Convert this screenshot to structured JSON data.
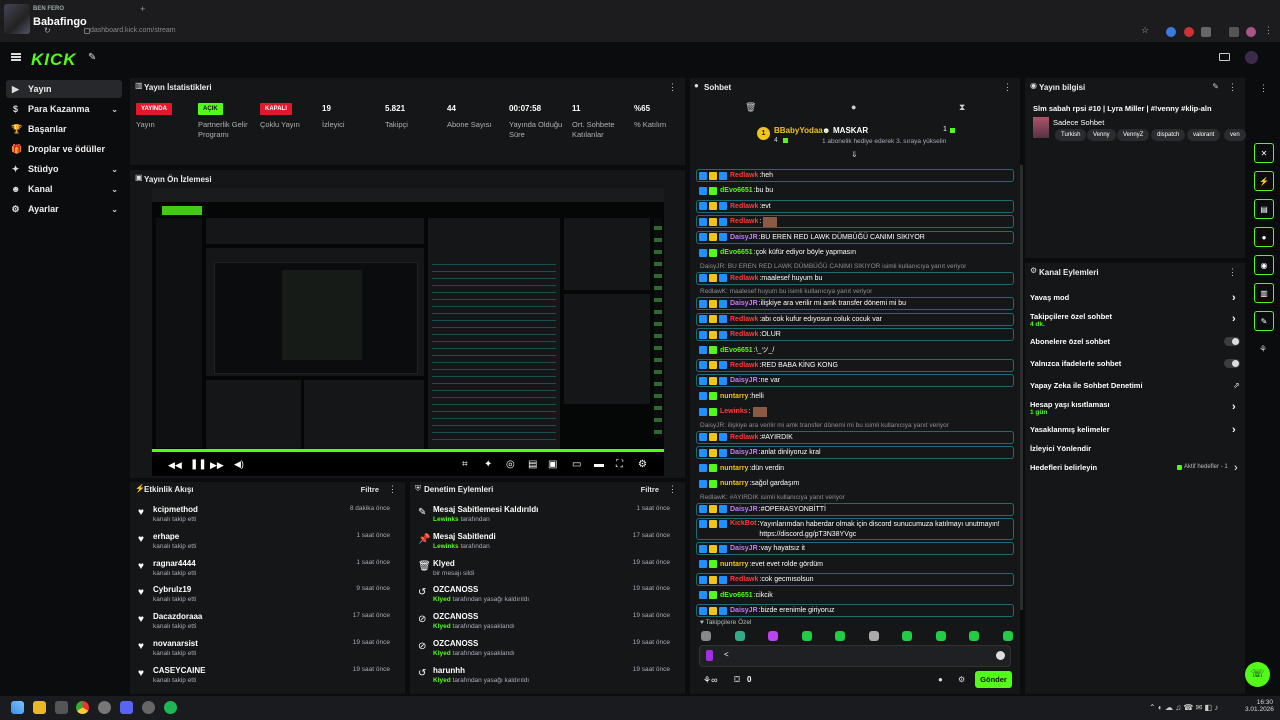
{
  "browser": {
    "profile_sub": "BEN FERO",
    "profile_name": "Babafingo",
    "url": "dashboard.kick.com/stream"
  },
  "header": {
    "logo": "KICK"
  },
  "sidebar": {
    "items": [
      {
        "label": "Yayın",
        "icon": "video-icon",
        "active": true,
        "expand": false
      },
      {
        "label": "Para Kazanma",
        "icon": "money-icon",
        "expand": true
      },
      {
        "label": "Başarılar",
        "icon": "trophy-icon",
        "expand": false
      },
      {
        "label": "Droplar ve ödüller",
        "icon": "gift-icon",
        "expand": false
      },
      {
        "label": "Stüdyo",
        "icon": "studio-icon",
        "expand": true
      },
      {
        "label": "Kanal",
        "icon": "user-icon",
        "expand": true
      },
      {
        "label": "Ayarlar",
        "icon": "gear-icon",
        "expand": true
      }
    ]
  },
  "stats": {
    "title": "Yayın İstatistikleri",
    "items": [
      {
        "badge": "YAYINDA",
        "label": "Yayın"
      },
      {
        "badge": "AÇIK",
        "label": "Partnerlik Gelir Programı"
      },
      {
        "badge": "KAPALI",
        "label": "Çoklu Yayın"
      },
      {
        "value": "19",
        "label": "İzleyici"
      },
      {
        "value": "5.821",
        "label": "Takipçi"
      },
      {
        "value": "44",
        "label": "Abone Sayısı"
      },
      {
        "value": "00:07:58",
        "label": "Yayında Olduğu Süre"
      },
      {
        "value": "11",
        "label": "Ort. Sohbete Katılanlar"
      },
      {
        "value": "%65",
        "label": "% Katılım"
      }
    ]
  },
  "preview": {
    "title": "Yayın Ön İzlemesi"
  },
  "activity": {
    "title": "Etkinlik Akışı",
    "filter": "Filtre",
    "rows": [
      {
        "name": "kcipmethod",
        "sub": "kanalı takip etti",
        "time": "8 dakika önce"
      },
      {
        "name": "erhape",
        "sub": "kanalı takip etti",
        "time": "1 saat önce"
      },
      {
        "name": "ragnar4444",
        "sub": "kanalı takip etti",
        "time": "1 saat önce"
      },
      {
        "name": "Cybrulz19",
        "sub": "kanalı takip etti",
        "time": "9 saat önce"
      },
      {
        "name": "Dacazdoraaa",
        "sub": "kanalı takip etti",
        "time": "17 saat önce"
      },
      {
        "name": "novanarsist",
        "sub": "kanalı takip etti",
        "time": "19 saat önce"
      },
      {
        "name": "CASEYCAINE",
        "sub": "kanalı takip etti",
        "time": "19 saat önce"
      }
    ]
  },
  "moderation": {
    "title": "Denetim Eylemleri",
    "filter": "Filtre",
    "rows": [
      {
        "icon": "unpin-icon",
        "name": "Mesaj Sabitlemesi Kaldırıldı",
        "actor": "Lewinks",
        "sub": "tarafından",
        "time": "1 saat önce"
      },
      {
        "icon": "pin-icon",
        "name": "Mesaj Sabitlendi",
        "actor": "Lewinks",
        "sub": "tarafından",
        "time": "17 saat önce"
      },
      {
        "icon": "trash-icon",
        "name": "Klyed",
        "actor": "",
        "sub": "bir mesajı sildi",
        "time": "19 saat önce"
      },
      {
        "icon": "undo-icon",
        "name": "OZCANOSS",
        "actor": "Klyed",
        "sub": "tarafından yasağı kaldırıldı",
        "time": "19 saat önce"
      },
      {
        "icon": "ban-icon",
        "name": "OZCANOSS",
        "actor": "Klyed",
        "sub": "tarafından yasaklandı",
        "time": "19 saat önce"
      },
      {
        "icon": "ban-icon",
        "name": "OZCANOSS",
        "actor": "Klyed",
        "sub": "tarafından yasaklandı",
        "time": "19 saat önce"
      },
      {
        "icon": "undo-icon",
        "name": "harunhh",
        "actor": "Klyed",
        "sub": "tarafından yasağı kaldırıldı",
        "time": "19 saat önce"
      }
    ]
  },
  "chat": {
    "title": "Sohbet",
    "pinned_user": "BBabyYodaa",
    "pinned_num": "4",
    "pinned_target": "MASKAR",
    "pinned_count": "1",
    "pinned_msg": "1 abonelik hediye ederek 3. sıraya yükselin",
    "messages": [
      {
        "user": "Redlawk",
        "color": "#ff3b3b",
        "text": "heh"
      },
      {
        "user": "dEvo6651",
        "color": "#53fc18",
        "text": "bu bu",
        "plain": true
      },
      {
        "user": "Redlawk",
        "color": "#ff3b3b",
        "text": "evt"
      },
      {
        "user": "Redlawk",
        "color": "#ff3b3b",
        "text": ""
      },
      {
        "user": "DaisyJR",
        "color": "#c57cff",
        "text": "BU EREN RED LAWK DÜMBÜĞÜ CANIMI SIKIYOR"
      },
      {
        "user": "dEvo6651",
        "color": "#53fc18",
        "text": "çok küfür ediyor böyle yapmasın",
        "plain": true
      },
      {
        "reply": "DaisyJR: BU EREN RED LAWK DÜMBÜĞÜ CANIMI SIKIYOR isimli kullanıcıya yanıt veriyor"
      },
      {
        "user": "Redlawk",
        "color": "#ff3b3b",
        "text": "maalesef huyum bu"
      },
      {
        "reply": "RedlawK: maalesef huyum bu isimli kullanıcıya yanıt veriyor"
      },
      {
        "user": "DaisyJR",
        "color": "#c57cff",
        "text": "ilişkiye ara verilir mi amk transfer dönemi mi bu"
      },
      {
        "user": "Redlawk",
        "color": "#ff3b3b",
        "text": "abı cok kufur edıyosun coluk cocuk var"
      },
      {
        "user": "Redlawk",
        "color": "#ff3b3b",
        "text": "OLUR"
      },
      {
        "user": "dEvo6651",
        "color": "#53fc18",
        "text": "\\_ツ_/",
        "plain": true
      },
      {
        "user": "Redlawk",
        "color": "#ff3b3b",
        "text": "RED BABA KİNG KONG"
      },
      {
        "user": "DaisyJR",
        "color": "#c57cff",
        "text": "ne var"
      },
      {
        "user": "nuntarry",
        "color": "#f0c419",
        "text": "helli",
        "plain": true
      },
      {
        "user": "Lewinks",
        "color": "#ff3b3b",
        "text": "",
        "plain": true
      },
      {
        "reply": "DaisyJR: ilişkiye ara verilir mi amk transfer dönemi mi bu isimli kullanıcıya yanıt veriyor"
      },
      {
        "user": "Redlawk",
        "color": "#ff3b3b",
        "text": "#AYIRDIK"
      },
      {
        "user": "DaisyJR",
        "color": "#c57cff",
        "text": "anlat dinliyoruz kral"
      },
      {
        "user": "nuntarry",
        "color": "#f0c419",
        "text": "dün verdin",
        "plain": true
      },
      {
        "user": "nuntarry",
        "color": "#f0c419",
        "text": "sağol gardaşım",
        "plain": true
      },
      {
        "reply": "RedlawK: #AYIRDIK isimli kullanıcıya yanıt veriyor"
      },
      {
        "user": "DaisyJR",
        "color": "#c57cff",
        "text": "#OPERASYONBİTTİ"
      },
      {
        "user": "KickBot",
        "color": "#ff3b3b",
        "text": "Yayınlarımdan haberdar olmak için discord sunucumuza katılmayı unutmayın! https://discord.gg/pT3N38YVgc",
        "tall": true
      },
      {
        "user": "DaisyJR",
        "color": "#c57cff",
        "text": "vay hayatsız it"
      },
      {
        "user": "nuntarry",
        "color": "#f0c419",
        "text": "evet evet rolde gördüm",
        "plain": true
      },
      {
        "user": "Redlawk",
        "color": "#ff3b3b",
        "text": "cok gecmısolsun"
      },
      {
        "user": "dEvo6651",
        "color": "#53fc18",
        "text": "cikcik",
        "plain": true
      },
      {
        "user": "DaisyJR",
        "color": "#c57cff",
        "text": "bizde erenimle giriyoruz"
      }
    ],
    "emote_label": "Takipçilere Özel",
    "input_value": "<",
    "count": "0",
    "send_label": "Gönder"
  },
  "stream_info": {
    "title": "Yayın bilgisi",
    "stream_title": "Slm sabah rpsi #10 | Lyra Miller | #!venny #klip-aln",
    "category": "Sadece Sohbet",
    "tags": [
      "Turkish",
      "Venny",
      "VennyZ",
      "dispatch",
      "valorant",
      "ven"
    ]
  },
  "channel_actions": {
    "title": "Kanal Eylemleri",
    "rows": [
      {
        "label": "Yavaş mod",
        "sub": "",
        "control": "chevron"
      },
      {
        "label": "Takipçilere özel sohbet",
        "sub": "4 dk.",
        "control": "chevron"
      },
      {
        "label": "Abonelere özel sohbet",
        "sub": "",
        "control": "toggle"
      },
      {
        "label": "Yalnızca ifadelerle sohbet",
        "sub": "",
        "control": "toggle"
      },
      {
        "label": "Yapay Zeka ile Sohbet Denetimi",
        "sub": "",
        "control": "external"
      },
      {
        "label": "Hesap yaşı kısıtlaması",
        "sub": "1 gün",
        "control": "chevron"
      },
      {
        "label": "Yasaklanmış kelimeler",
        "sub": "",
        "control": "chevron"
      },
      {
        "label": "İzleyici Yönlendir",
        "sub": "",
        "control": "none"
      },
      {
        "label": "Hedefleri belirleyin",
        "sub": "",
        "control": "goal",
        "extra": "Aktif hedefler - 1"
      }
    ]
  },
  "taskbar": {
    "time": "16:30",
    "date": "3.01.2026"
  },
  "colors": {
    "accent": "#53fc18",
    "live": "#e5172d",
    "panel": "#151617",
    "bg": "#0b0c0d"
  }
}
